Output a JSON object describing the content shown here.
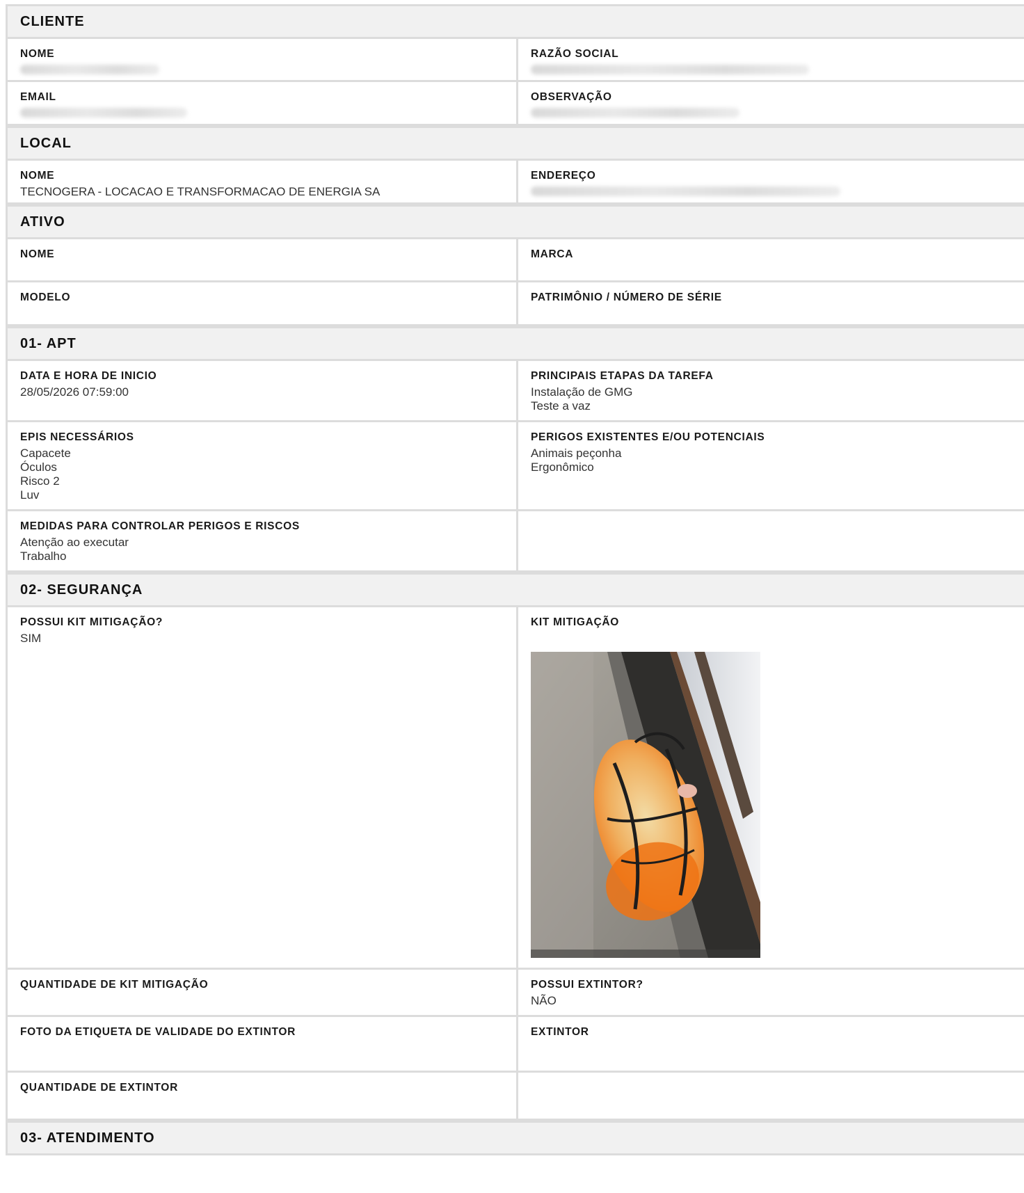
{
  "cliente": {
    "title": "CLIENTE",
    "nome_label": "NOME",
    "razao_label": "RAZÃO SOCIAL",
    "email_label": "EMAIL",
    "obs_label": "OBSERVAÇÃO"
  },
  "local": {
    "title": "LOCAL",
    "nome_label": "NOME",
    "nome_value": "TECNOGERA - LOCACAO E TRANSFORMACAO DE ENERGIA SA",
    "endereco_label": "ENDEREÇO"
  },
  "ativo": {
    "title": "ATIVO",
    "nome_label": "NOME",
    "marca_label": "MARCA",
    "modelo_label": "MODELO",
    "patrimonio_label": "PATRIMÔNIO / NÚMERO DE SÉRIE"
  },
  "apt": {
    "title": "01- APT",
    "data_label": "DATA E HORA DE INICIO",
    "data_value": "28/05/2026 07:59:00",
    "etapas_label": "PRINCIPAIS ETAPAS DA TAREFA",
    "etapas_values": [
      "Instalação de GMG",
      "Teste a vaz"
    ],
    "epis_label": "EPIS NECESSÁRIOS",
    "epis_values": [
      "Capacete",
      "Óculos",
      "Risco 2",
      "Luv"
    ],
    "perigos_label": "PERIGOS EXISTENTES E/OU POTENCIAIS",
    "perigos_values": [
      "Animais peçonha",
      "Ergonômico"
    ],
    "medidas_label": "MEDIDAS PARA CONTROLAR PERIGOS E RISCOS",
    "medidas_values": [
      "Atenção ao executar",
      "Trabalho"
    ]
  },
  "seguranca": {
    "title": "02- SEGURANÇA",
    "possui_kit_label": "POSSUI KIT MITIGAÇÃO?",
    "possui_kit_value": "SIM",
    "kit_label": "KIT MITIGAÇÃO",
    "qtd_kit_label": "QUANTIDADE DE KIT MITIGAÇÃO",
    "possui_extintor_label": "POSSUI EXTINTOR?",
    "possui_extintor_value": "NÃO",
    "foto_etiqueta_label": "FOTO DA ETIQUETA DE VALIDADE DO EXTINTOR",
    "extintor_label": "EXTINTOR",
    "qtd_extintor_label": "QUANTIDADE DE EXTINTOR"
  },
  "atendimento": {
    "title": "03- ATENDIMENTO"
  }
}
